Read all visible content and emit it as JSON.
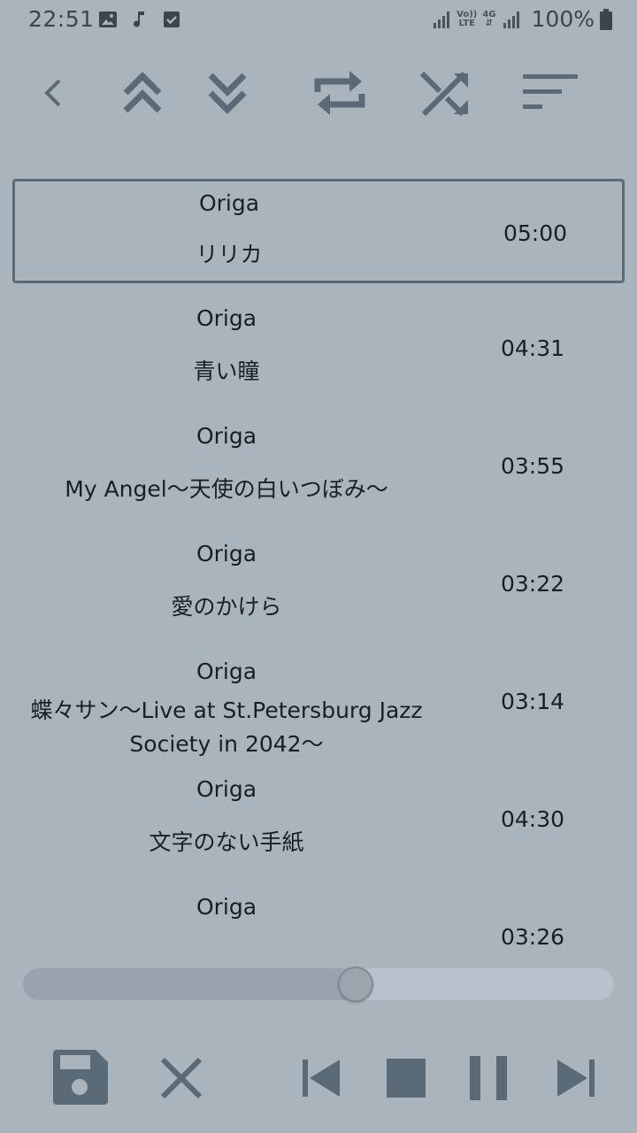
{
  "status_bar": {
    "time": "22:51",
    "battery": "100%",
    "network_top": "Vo))",
    "network_bottom": "LTE",
    "network2_top": "4G",
    "icons": [
      "image-icon",
      "music-note-icon",
      "checkbox-icon",
      "signal-icon",
      "volte-icon",
      "4g-icon",
      "signal-icon",
      "battery-icon"
    ]
  },
  "toolbar": {
    "icons": [
      "back-icon",
      "move-up-icon",
      "move-down-icon",
      "repeat-icon",
      "shuffle-icon",
      "sort-icon"
    ]
  },
  "playlist": {
    "tracks": [
      {
        "artist": "Origa",
        "title": "リリカ",
        "duration": "05:00",
        "selected": true
      },
      {
        "artist": "Origa",
        "title": "青い瞳",
        "duration": "04:31"
      },
      {
        "artist": "Origa",
        "title": "My Angel〜天使の白いつぼみ〜",
        "duration": "03:55"
      },
      {
        "artist": "Origa",
        "title": "愛のかけら",
        "duration": "03:22"
      },
      {
        "artist": "Origa",
        "title_line1": "蝶々サン〜Live at St.Petersburg Jazz",
        "title_line2": "Society in 2042〜",
        "duration": "03:14"
      },
      {
        "artist": "Origa",
        "title": "文字のない手紙",
        "duration": "04:30"
      },
      {
        "artist": "Origa",
        "title": "",
        "duration": "03:26"
      }
    ]
  },
  "seek": {
    "progress": 0.56
  },
  "controls": {
    "icons": [
      "save-icon",
      "close-icon",
      "previous-icon",
      "stop-icon",
      "pause-icon",
      "next-icon"
    ]
  },
  "colors": {
    "background": "#a9b4bd",
    "icon": "#5b6a77",
    "text": "#1a1f24"
  }
}
